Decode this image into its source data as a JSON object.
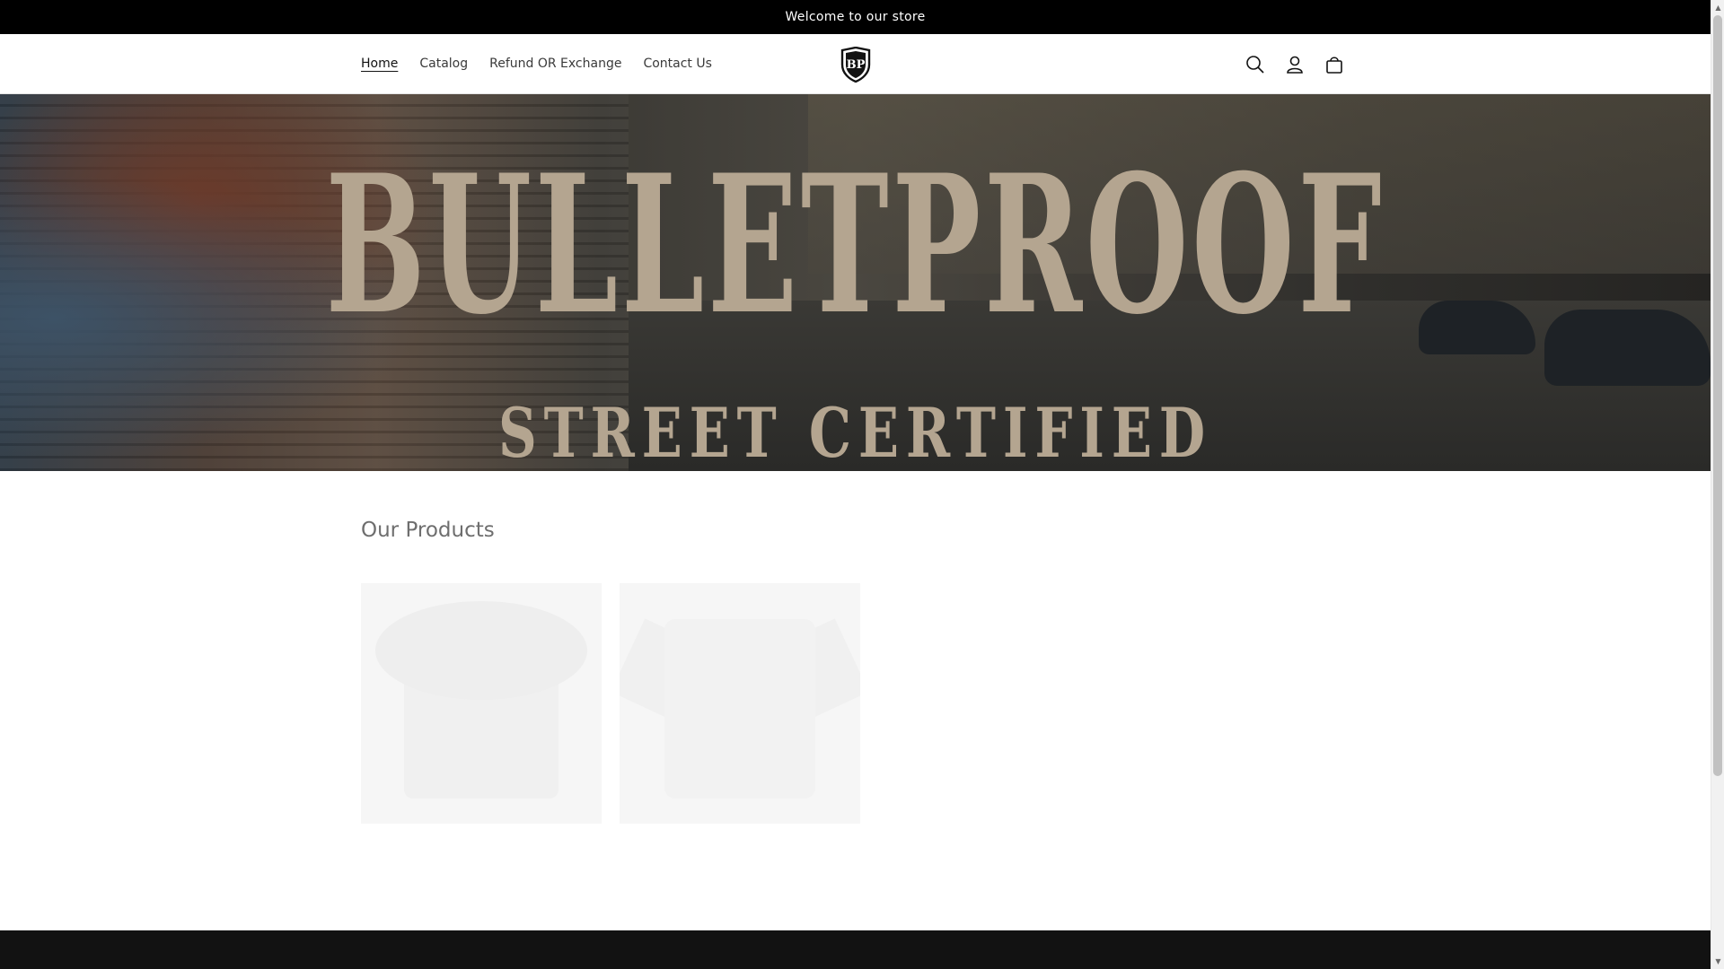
{
  "announcement": {
    "text": "Welcome to our store"
  },
  "nav": {
    "items": [
      {
        "label": "Home",
        "active": true
      },
      {
        "label": "Catalog",
        "active": false
      },
      {
        "label": "Refund OR Exchange",
        "active": false
      },
      {
        "label": "Contact Us",
        "active": false
      }
    ]
  },
  "logo": {
    "text": "BP"
  },
  "header_icons": [
    "search-icon",
    "account-icon",
    "cart-icon"
  ],
  "hero": {
    "title": "BULLETPROOF",
    "subtitle": "STREET CERTIFIED"
  },
  "products": {
    "heading": "Our Products",
    "items": [
      {
        "image": "hat"
      },
      {
        "image": "t-shirt"
      }
    ]
  },
  "colors": {
    "announcement_bg": "#000000",
    "hero_text": "#b4a590",
    "footer_bg": "#121212"
  }
}
